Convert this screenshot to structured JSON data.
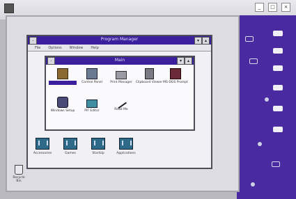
{
  "outer_window": {
    "title": ""
  },
  "program_manager": {
    "title": "Program Manager",
    "menu": [
      "File",
      "Options",
      "Window",
      "Help"
    ],
    "main_group": {
      "title": "Main",
      "icons": [
        {
          "label": "",
          "icon": "file-manager-icon",
          "selected": true
        },
        {
          "label": "Control Panel",
          "icon": "control-panel-icon"
        },
        {
          "label": "Print Manager",
          "icon": "printer-icon"
        },
        {
          "label": "Clipboard Viewer",
          "icon": "clipboard-icon"
        },
        {
          "label": "MS-DOS Prompt",
          "icon": "dos-icon"
        },
        {
          "label": "Windows Setup",
          "icon": "setup-icon"
        },
        {
          "label": "PIF Editor",
          "icon": "pif-editor-icon"
        },
        {
          "label": "Read Me",
          "icon": "read-me-icon"
        }
      ]
    },
    "groups": [
      {
        "label": "Accessories"
      },
      {
        "label": "Games"
      },
      {
        "label": "StartUp"
      },
      {
        "label": "Applications"
      }
    ]
  },
  "desktop": {
    "recycle_label": "Recycle Bin"
  },
  "colors": {
    "titlebar": "#3c1f9c",
    "sidebar": "#4a2aa0",
    "desktop": "#dcdce2"
  }
}
